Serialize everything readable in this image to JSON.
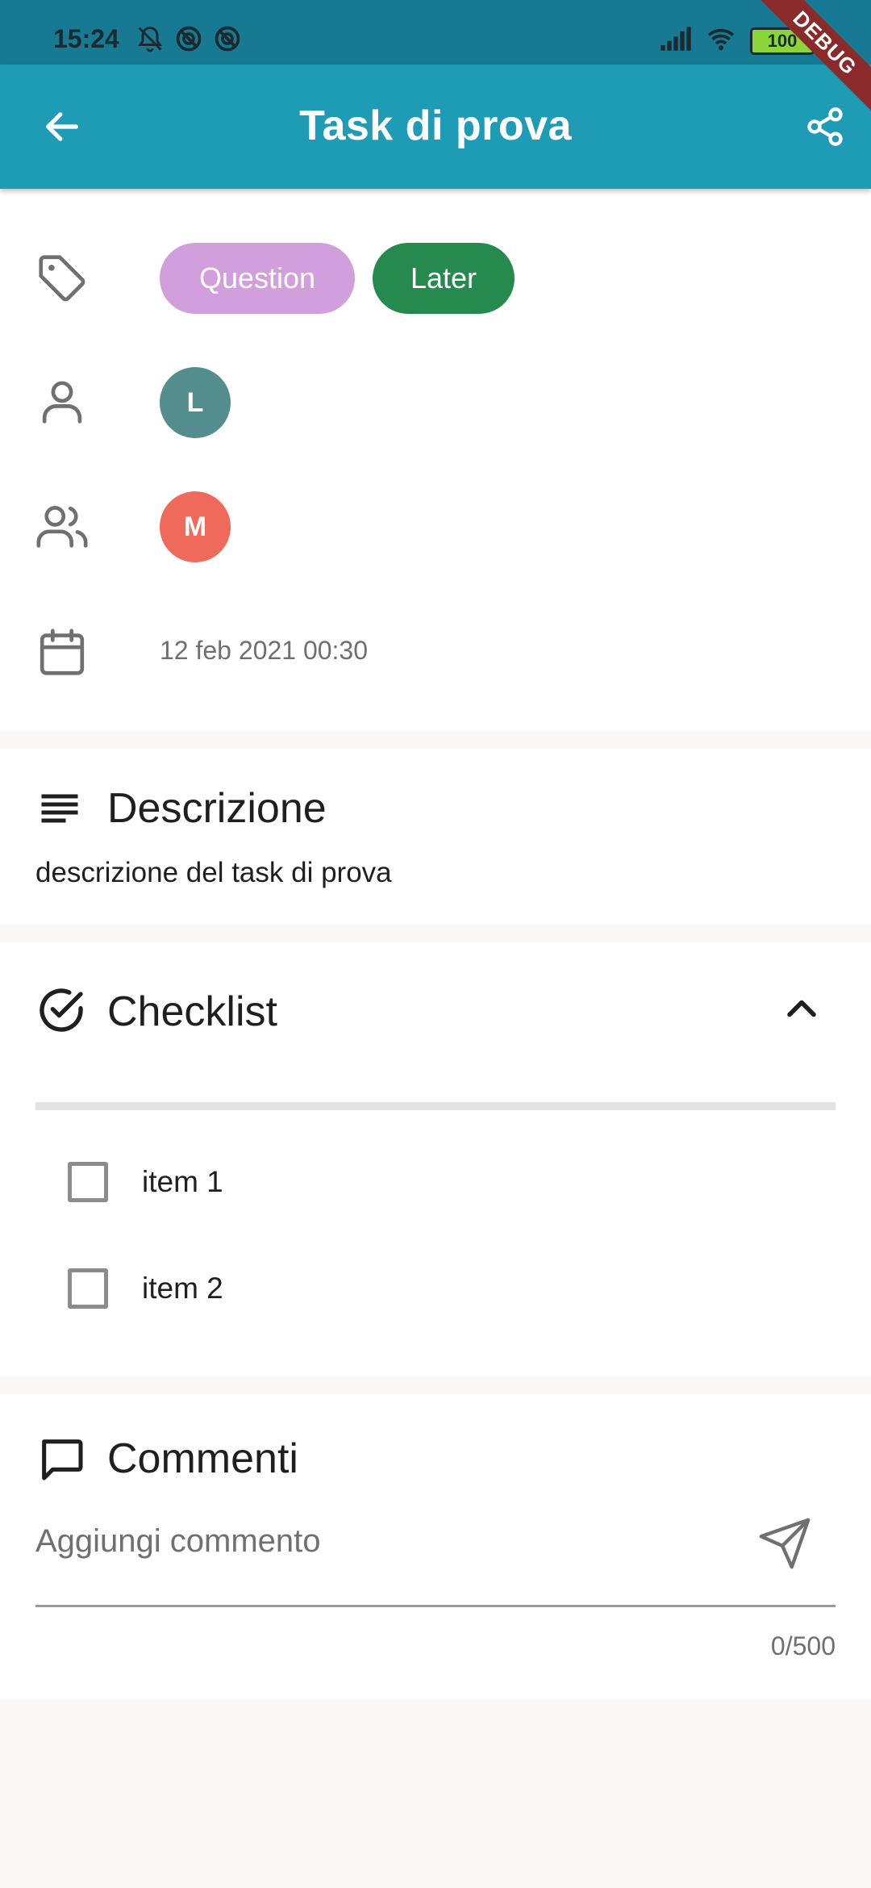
{
  "status_bar": {
    "time": "15:24",
    "battery": "100",
    "icons": [
      "mute-bell-icon",
      "dnd-icon",
      "dnd-icon",
      "signal-icon",
      "wifi-icon",
      "battery-icon"
    ]
  },
  "app_bar": {
    "title": "Task di prova",
    "back_icon": "arrow-back-icon",
    "share_icon": "share-icon",
    "debug_label": "DEBUG"
  },
  "colors": {
    "app_bar": "#1e9bb5",
    "status_bar": "#177a92",
    "chip_question": "#d29fdd",
    "chip_later": "#268a4f",
    "avatar_l": "#548d8d",
    "avatar_m": "#f06a5c"
  },
  "info": {
    "labels": [
      {
        "text": "Question",
        "color": "#d29fdd"
      },
      {
        "text": "Later",
        "color": "#268a4f"
      }
    ],
    "assignee": {
      "initial": "L",
      "color": "#548d8d"
    },
    "followers": [
      {
        "initial": "M",
        "color": "#f06a5c"
      }
    ],
    "date": "12 feb 2021 00:30"
  },
  "description": {
    "title": "Descrizione",
    "text": "descrizione del task di prova"
  },
  "checklist": {
    "title": "Checklist",
    "items": [
      {
        "label": "item 1",
        "checked": false
      },
      {
        "label": "item 2",
        "checked": false
      }
    ]
  },
  "comments": {
    "title": "Commenti",
    "placeholder": "Aggiungi commento",
    "value": "",
    "counter": "0/500"
  }
}
